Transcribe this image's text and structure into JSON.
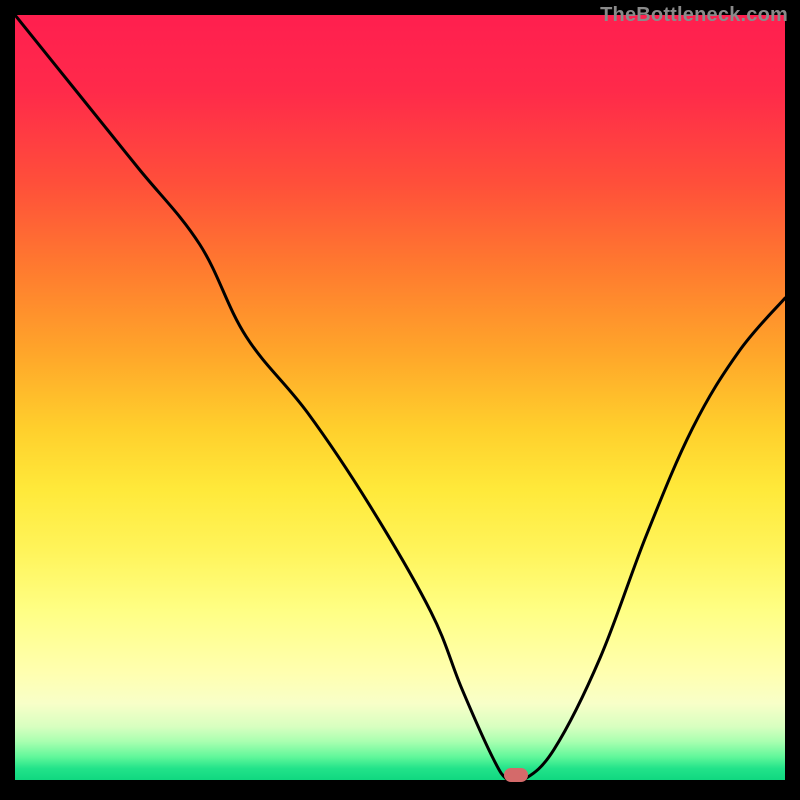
{
  "watermark": "TheBottleneck.com",
  "colors": {
    "background": "#000000",
    "curve": "#000000",
    "marker": "#d46a6a"
  },
  "chart_data": {
    "type": "line",
    "title": "",
    "xlabel": "",
    "ylabel": "",
    "xlim": [
      0,
      100
    ],
    "ylim": [
      0,
      100
    ],
    "grid": false,
    "series": [
      {
        "name": "bottleneck-curve",
        "x": [
          0,
          8,
          16,
          24,
          30,
          38,
          46,
          54,
          58,
          62,
          64,
          66,
          70,
          76,
          82,
          88,
          94,
          100
        ],
        "y": [
          100,
          90,
          80,
          70,
          58,
          48,
          36,
          22,
          12,
          3,
          0,
          0,
          4,
          16,
          32,
          46,
          56,
          63
        ]
      }
    ],
    "marker": {
      "x": 65,
      "y": 0.6,
      "shape": "rounded-pill"
    },
    "description": "Black V-shaped curve over a vertical red-to-green bottleneck gradient; minimum of the curve sits on the green band near x≈65 where a small reddish pill marker is drawn."
  }
}
